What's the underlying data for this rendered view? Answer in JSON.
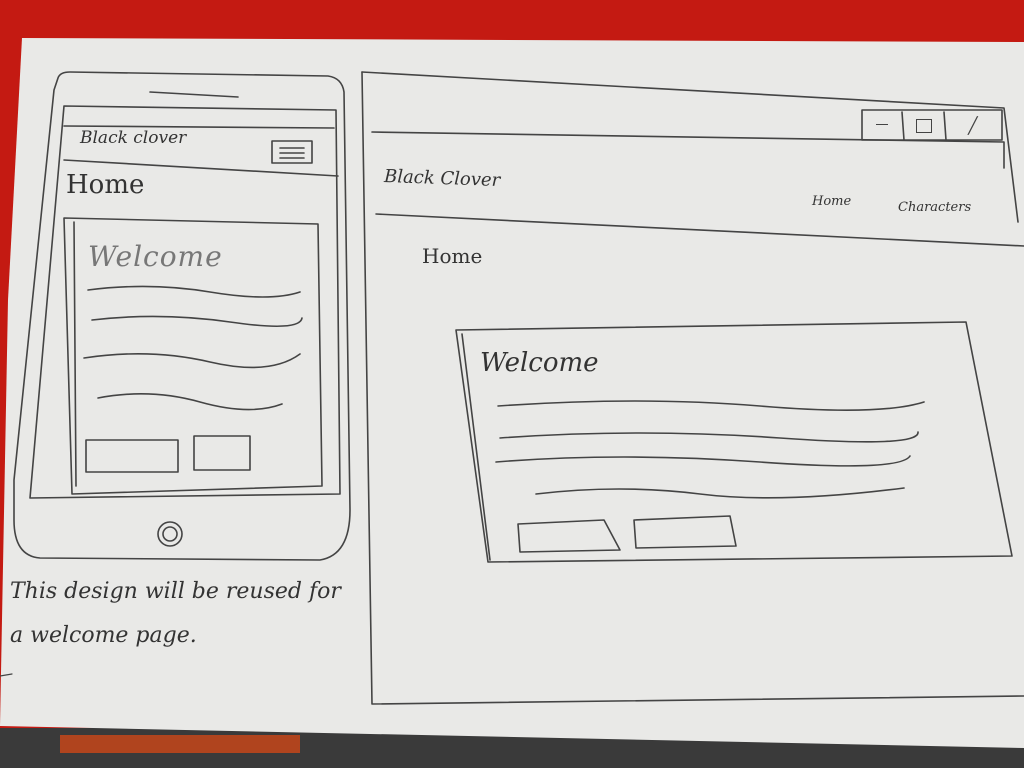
{
  "colors": {
    "background": "#c41a12",
    "paper": "#e9e9e7",
    "ink": "#333333"
  },
  "mobile": {
    "brand": "Black clover",
    "menu_icon": "hamburger-menu-icon",
    "page_title": "Home",
    "card_heading": "Welcome",
    "home_button_icon": "home-button-icon"
  },
  "desktop": {
    "window_controls": [
      "minimize-icon",
      "maximize-icon",
      "close-icon"
    ],
    "brand": "Black Clover",
    "nav": {
      "home": "Home",
      "characters": "Characters"
    },
    "page_title": "Home",
    "card_heading": "Welcome"
  },
  "note": "This design will be reused for a welcome page."
}
